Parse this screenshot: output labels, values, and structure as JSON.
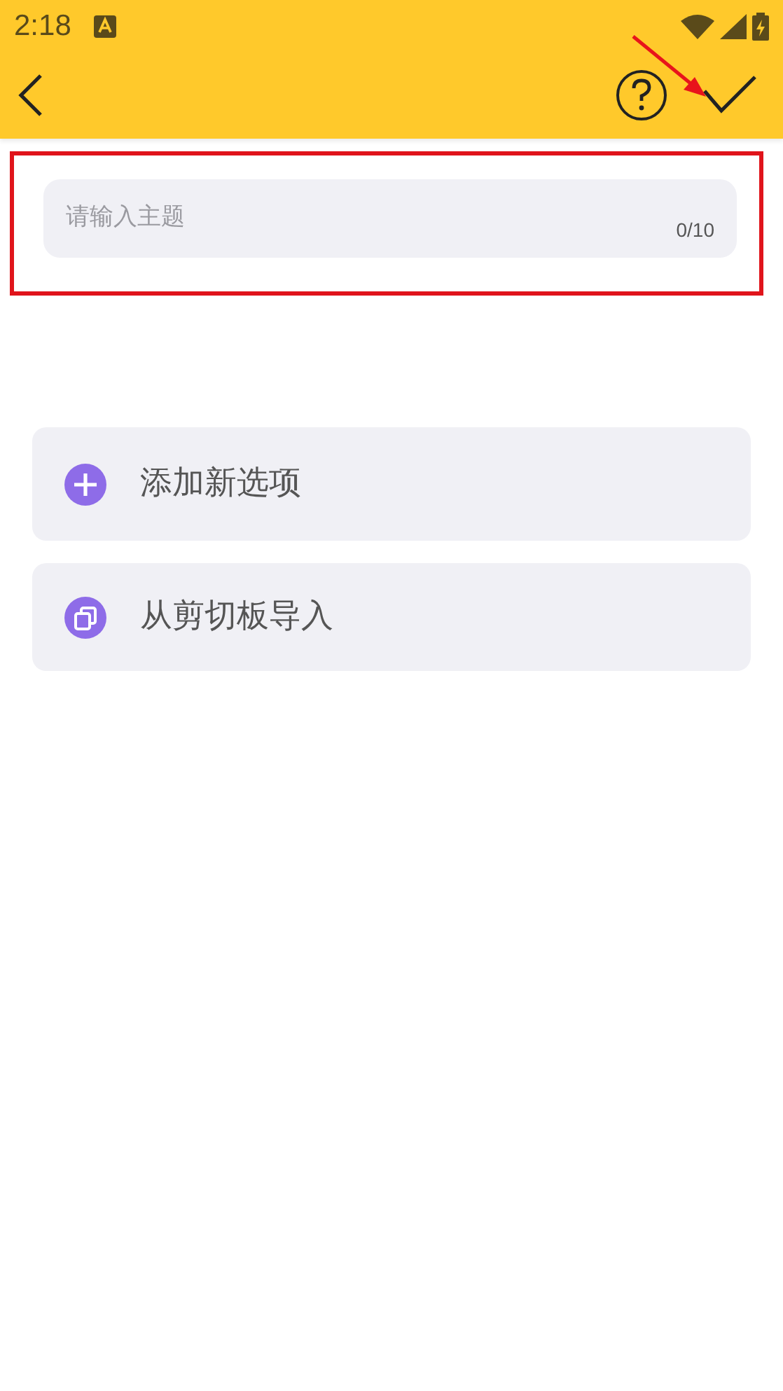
{
  "status_bar": {
    "time": "2:18"
  },
  "topic_field": {
    "placeholder": "请输入主题",
    "counter": "0/10"
  },
  "actions": [
    {
      "kind": "add",
      "label": "添加新选项"
    },
    {
      "kind": "import",
      "label": "从剪切板导入"
    }
  ]
}
